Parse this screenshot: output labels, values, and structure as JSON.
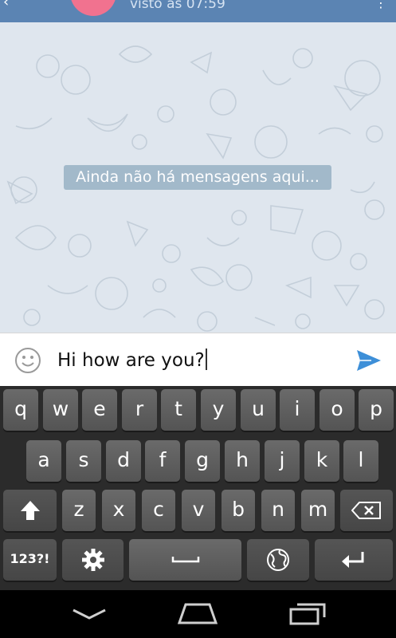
{
  "header": {
    "status": "visto às 07:59",
    "avatar_color": "#f1728f"
  },
  "chat": {
    "empty_message": "Ainda não há mensagens aqui..."
  },
  "input": {
    "value": "Hi how are you?"
  },
  "keyboard": {
    "row1": [
      "q",
      "w",
      "e",
      "r",
      "t",
      "y",
      "u",
      "i",
      "o",
      "p"
    ],
    "row2": [
      "a",
      "s",
      "d",
      "f",
      "g",
      "h",
      "j",
      "k",
      "l"
    ],
    "row3": [
      "z",
      "x",
      "c",
      "v",
      "b",
      "n",
      "m"
    ],
    "symbols_label": "123?!"
  },
  "colors": {
    "accent": "#5b84b3",
    "send": "#3d8fd8"
  }
}
